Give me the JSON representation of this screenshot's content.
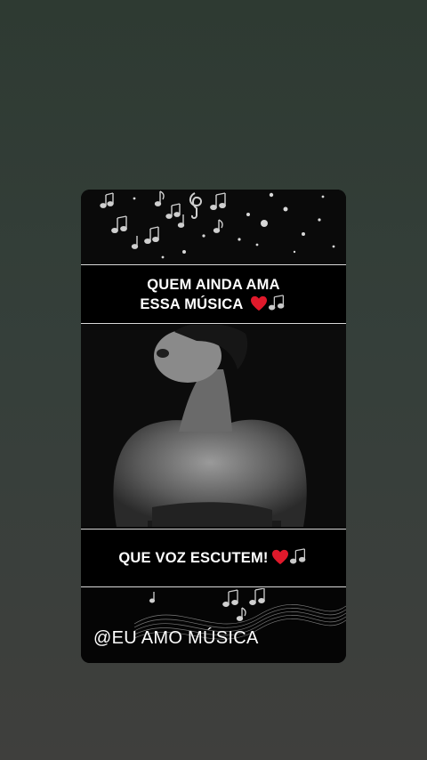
{
  "story": {
    "caption_top_line1": "QUEM AINDA AMA",
    "caption_top_line2": "ESSA MÚSICA",
    "caption_bottom": "QUE VOZ ESCUTEM!",
    "watermark": "@EU AMO MÚSICA",
    "icons": [
      "heart-icon",
      "music-notes-icon"
    ],
    "colors": {
      "heart": "#e0192b",
      "band": "#000000",
      "text": "#ffffff"
    }
  }
}
